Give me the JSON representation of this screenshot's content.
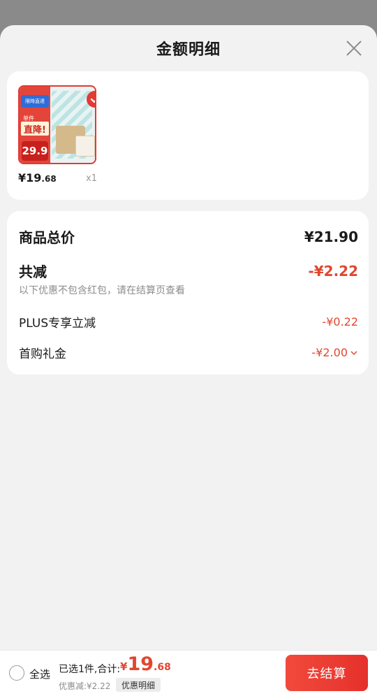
{
  "sheet": {
    "title": "金额明细"
  },
  "product": {
    "thumb_tag": "限時直達",
    "thumb_sub": "单件",
    "thumb_big": "直降!",
    "thumb_price": "29.9",
    "price_int": "¥19",
    "price_dec": ".68",
    "qty": "x1"
  },
  "summary": {
    "total_label": "商品总价",
    "total_value": "¥21.90",
    "reduce_label": "共减",
    "reduce_value": "-¥2.22",
    "note": "以下优惠不包含红包，请在结算页查看",
    "items": [
      {
        "label": "PLUS专享立减",
        "value": "-¥0.22"
      },
      {
        "label": "首购礼金",
        "value": "-¥2.00"
      }
    ]
  },
  "bottom_bar": {
    "select_all": "全选",
    "selected_text": "已选1件,合计:",
    "total_symbol": "¥",
    "total_int": "19",
    "total_dec": ".68",
    "discount": "优惠减:¥2.22",
    "detail_tag": "优惠明细",
    "checkout": "去结算"
  },
  "colors": {
    "accent_red": "#e2462f",
    "checkout_red": "#e5312b",
    "sheet_bg": "#f2f2f2"
  },
  "icons": {
    "close": "close-icon",
    "check": "check-badge-icon",
    "chevron": "chevron-down-icon"
  }
}
